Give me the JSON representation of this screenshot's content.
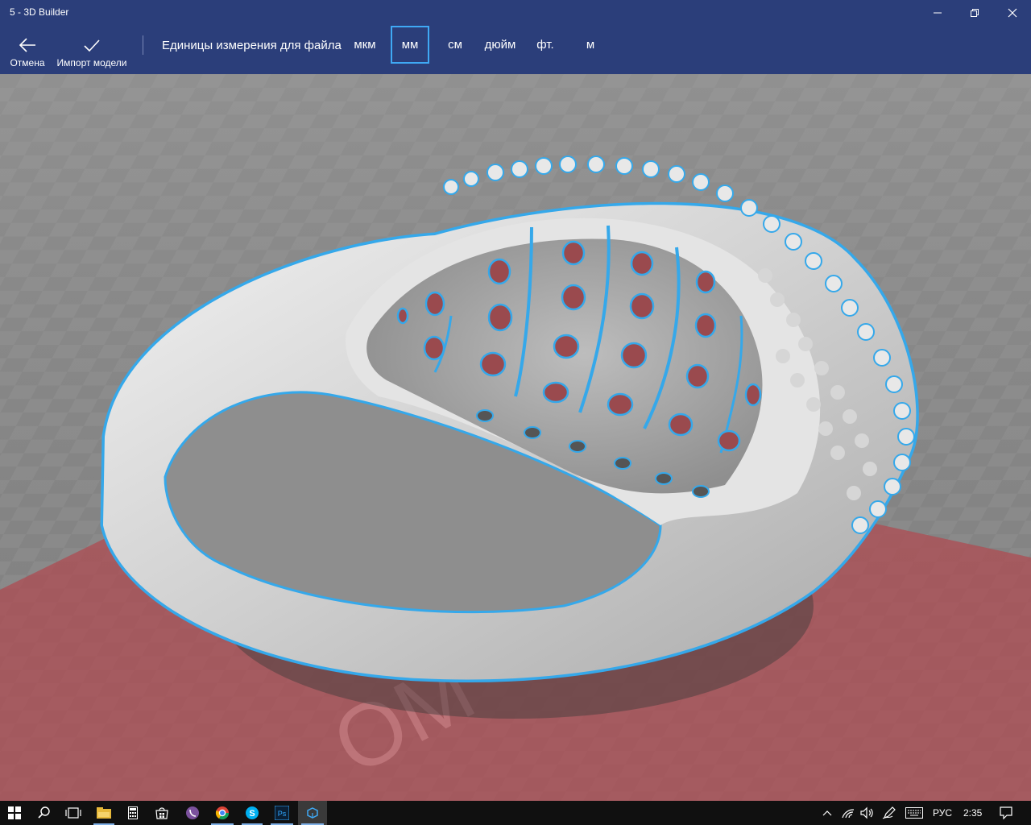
{
  "window": {
    "title": "5 - 3D Builder",
    "controls": [
      "minimize-icon",
      "restore-icon",
      "close-icon"
    ]
  },
  "commandbar": {
    "cancel_label": "Отмена",
    "cancel_icon": "back-arrow-icon",
    "import_label": "Импорт модели",
    "import_icon": "checkmark-icon",
    "units_label": "Единицы измерения для файла",
    "units": [
      {
        "label": "мкм",
        "selected": false
      },
      {
        "label": "мм",
        "selected": true
      },
      {
        "label": "см",
        "selected": false
      },
      {
        "label": "дюйм",
        "selected": false
      },
      {
        "label": "фт.",
        "selected": false
      },
      {
        "label": "м",
        "selected": false
      }
    ]
  },
  "viewport": {
    "model": "ring-3d-model",
    "highlight_color": "#35a8ea",
    "platform_color": "#b04a50",
    "model_color": "#d9d9d9"
  },
  "taskbar": {
    "apps": [
      "windows-start-icon",
      "search-icon",
      "task-view-icon",
      "file-explorer-icon",
      "calculator-icon",
      "store-icon",
      "viber-icon",
      "chrome-icon",
      "skype-icon",
      "photoshop-icon",
      "3d-builder-icon"
    ],
    "language": "РУС",
    "time": "2:35"
  },
  "colors": {
    "titlebar": "#2b3e7a",
    "accent": "#3fa9f5",
    "taskbar": "#101010"
  }
}
